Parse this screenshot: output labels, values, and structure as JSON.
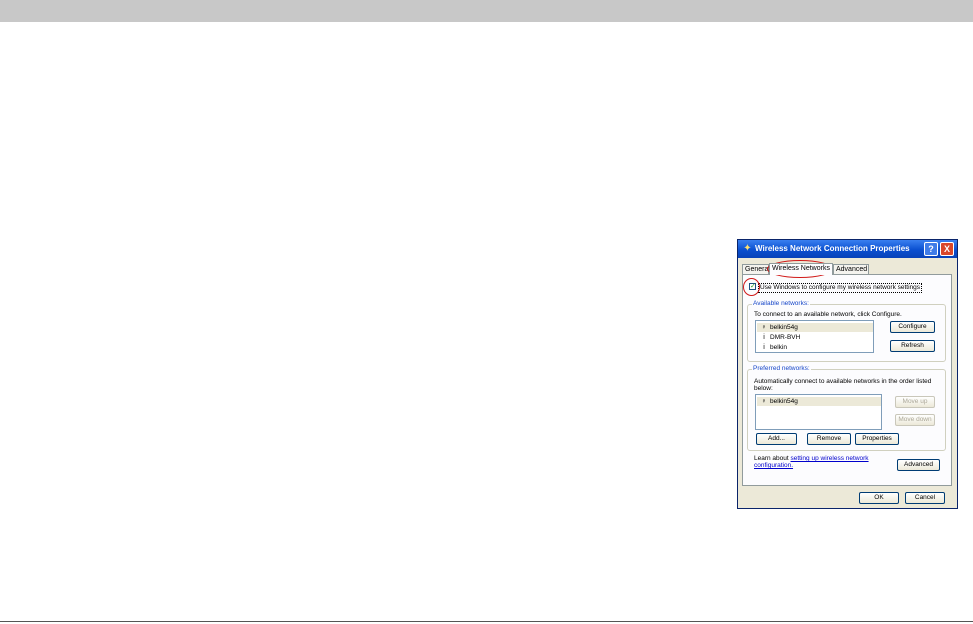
{
  "dialog": {
    "title": "Wireless Network Connection Properties",
    "help_label": "?",
    "close_label": "X",
    "tabs": [
      {
        "label": "General"
      },
      {
        "label": "Wireless Networks"
      },
      {
        "label": "Advanced"
      }
    ],
    "active_tab": "Wireless Networks",
    "use_windows": {
      "label": "Use Windows to configure my wireless network settings",
      "checked": true
    },
    "available": {
      "group_title": "Available networks:",
      "instruction": "To connect to an available network, click Configure.",
      "networks": [
        "belkin54g",
        "DMR-BVH",
        "belkin"
      ],
      "configure_label": "Configure",
      "refresh_label": "Refresh"
    },
    "preferred": {
      "group_title": "Preferred networks:",
      "instruction_line1": "Automatically connect to available networks in the order listed",
      "instruction_line2": "below:",
      "networks": [
        "belkin54g"
      ],
      "move_up_label": "Move up",
      "move_down_label": "Move down",
      "add_label": "Add...",
      "remove_label": "Remove",
      "properties_label": "Properties"
    },
    "learn": {
      "prefix": "Learn about ",
      "link_text": "setting up wireless network configuration."
    },
    "advanced_label": "Advanced",
    "ok_label": "OK",
    "cancel_label": "Cancel"
  },
  "colors": {
    "titlebar": "#0a4fd0",
    "dialog_face": "#ece9d8",
    "highlight": "#d01818",
    "link": "#0000cc",
    "group_title": "#1646c8"
  },
  "icons": {
    "title": "network-icon",
    "secure_network": "antenna-icon",
    "open_network": "info-antenna-icon"
  }
}
